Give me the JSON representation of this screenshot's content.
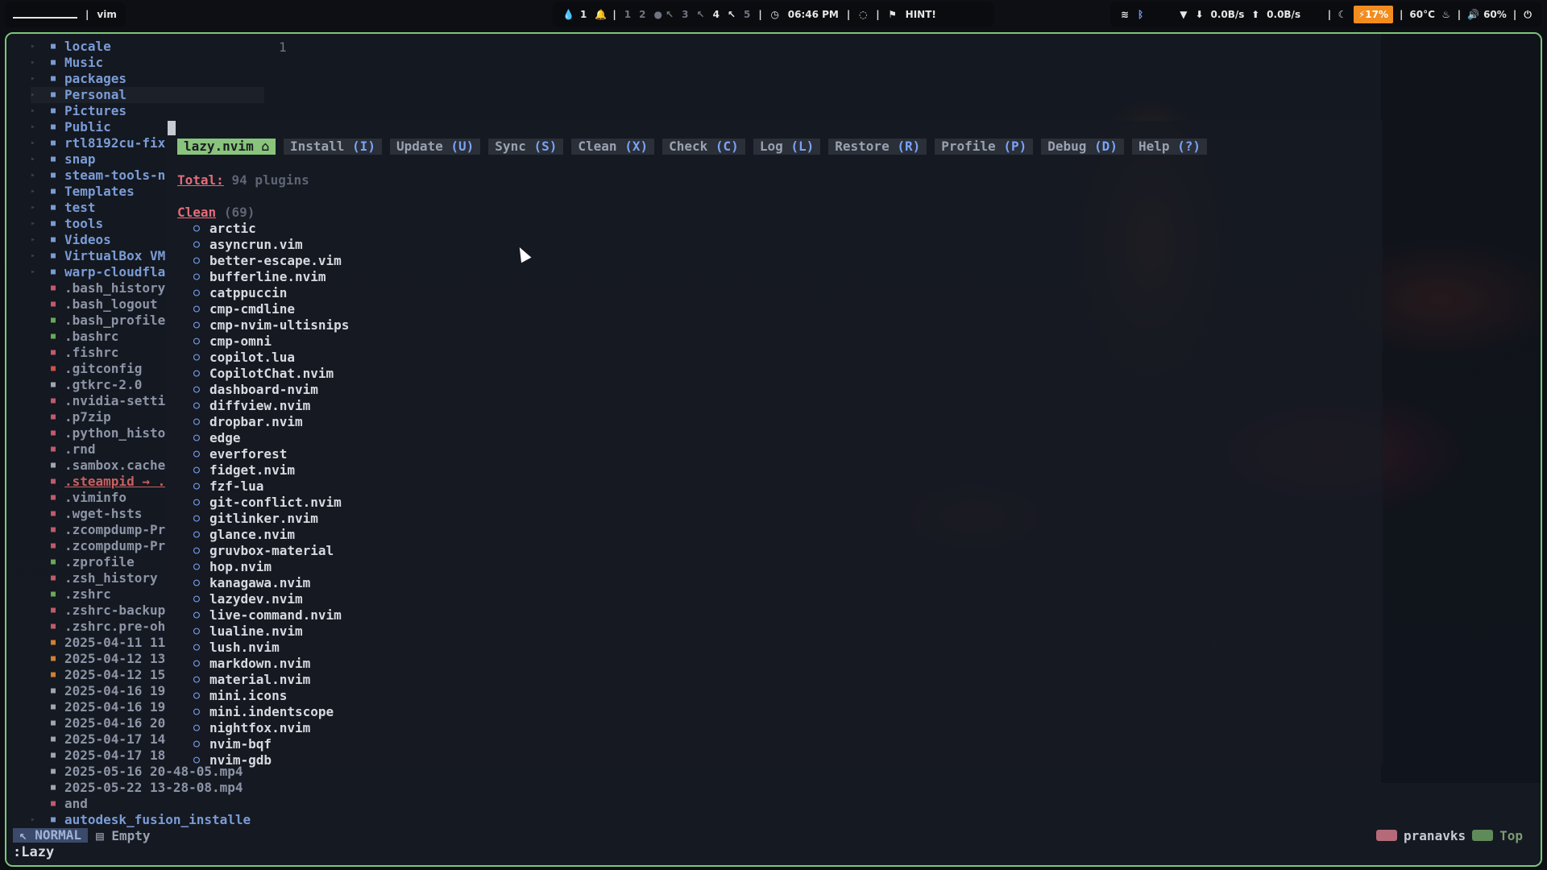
{
  "topbar": {
    "workspace_label": "vim",
    "notif_count": "1",
    "workspaces": [
      "1",
      "2",
      "3",
      "4",
      "5"
    ],
    "time": "06:46 PM",
    "hint": "HINT!",
    "net_down": "0.0B/s",
    "net_up": "0.0B/s",
    "battery": "17%",
    "temp": "60°C",
    "volume": "60%"
  },
  "tree": [
    {
      "name": "locale",
      "type": "dir"
    },
    {
      "name": "Music",
      "type": "dir"
    },
    {
      "name": "packages",
      "type": "dir"
    },
    {
      "name": "Personal",
      "type": "dir",
      "selected": true
    },
    {
      "name": "Pictures",
      "type": "dir"
    },
    {
      "name": "Public",
      "type": "dir"
    },
    {
      "name": "rtl8192cu-fix",
      "type": "dir"
    },
    {
      "name": "snap",
      "type": "dir"
    },
    {
      "name": "steam-tools-n",
      "type": "dir"
    },
    {
      "name": "Templates",
      "type": "dir"
    },
    {
      "name": "test",
      "type": "dir"
    },
    {
      "name": "tools",
      "type": "dir"
    },
    {
      "name": "Videos",
      "type": "dir"
    },
    {
      "name": "VirtualBox VM",
      "type": "dir"
    },
    {
      "name": "warp-cloudfla",
      "type": "dir"
    },
    {
      "name": ".bash_history",
      "type": "file",
      "color": "#c05a6e"
    },
    {
      "name": ".bash_logout",
      "type": "file",
      "color": "#c05a6e"
    },
    {
      "name": ".bash_profile",
      "type": "file",
      "color": "#6aa85a"
    },
    {
      "name": ".bashrc",
      "type": "file",
      "color": "#6aa85a"
    },
    {
      "name": ".fishrc",
      "type": "file",
      "color": "#c05a6e"
    },
    {
      "name": ".gitconfig",
      "type": "file",
      "color": "#d05040"
    },
    {
      "name": ".gtkrc-2.0",
      "type": "file",
      "color": "#a0a6b2"
    },
    {
      "name": ".nvidia-setti",
      "type": "file",
      "color": "#c05a6e"
    },
    {
      "name": ".p7zip",
      "type": "file",
      "color": "#c05a6e"
    },
    {
      "name": ".python_histo",
      "type": "file",
      "color": "#c05a6e"
    },
    {
      "name": ".rnd",
      "type": "file",
      "color": "#c05a6e"
    },
    {
      "name": ".sambox.cache",
      "type": "file",
      "color": "#a0a6b2"
    },
    {
      "name": ".steampid → .",
      "type": "link",
      "color": "#c05a6e"
    },
    {
      "name": ".viminfo",
      "type": "file",
      "color": "#c05a6e"
    },
    {
      "name": ".wget-hsts",
      "type": "file",
      "color": "#c05a6e"
    },
    {
      "name": ".zcompdump-Pr",
      "type": "file",
      "color": "#c05a6e"
    },
    {
      "name": ".zcompdump-Pr",
      "type": "file",
      "color": "#c05a6e"
    },
    {
      "name": ".zprofile",
      "type": "file",
      "color": "#6aa85a"
    },
    {
      "name": ".zsh_history",
      "type": "file",
      "color": "#c05a6e"
    },
    {
      "name": ".zshrc",
      "type": "file",
      "color": "#6aa85a"
    },
    {
      "name": ".zshrc-backup",
      "type": "file",
      "color": "#c05a6e"
    },
    {
      "name": ".zshrc.pre-oh",
      "type": "file",
      "color": "#c05a6e"
    },
    {
      "name": "2025-04-11 11",
      "type": "file",
      "color": "#d08030"
    },
    {
      "name": "2025-04-12 13",
      "type": "file",
      "color": "#d08030"
    },
    {
      "name": "2025-04-12 15",
      "type": "file",
      "color": "#d08030"
    },
    {
      "name": "2025-04-16 19",
      "type": "file",
      "color": "#a0a6b2"
    },
    {
      "name": "2025-04-16 19",
      "type": "file",
      "color": "#a0a6b2"
    },
    {
      "name": "2025-04-16 20",
      "type": "file",
      "color": "#a0a6b2"
    },
    {
      "name": "2025-04-17 14",
      "type": "file",
      "color": "#a0a6b2"
    },
    {
      "name": "2025-04-17 18",
      "type": "file",
      "color": "#a0a6b2"
    },
    {
      "name": "2025-05-16 20-48-05.mp4",
      "type": "file",
      "color": "#a0a6b2"
    },
    {
      "name": "2025-05-22 13-28-08.mp4",
      "type": "file",
      "color": "#a0a6b2"
    },
    {
      "name": "and",
      "type": "file",
      "color": "#c05a6e"
    },
    {
      "name": "autodesk_fusion_installe",
      "type": "dir"
    }
  ],
  "editor": {
    "line_number": "1"
  },
  "lazy": {
    "tabs": [
      {
        "label": "lazy.nvim ⌂",
        "key": "",
        "active": true
      },
      {
        "label": "Install",
        "key": "(I)"
      },
      {
        "label": "Update",
        "key": "(U)"
      },
      {
        "label": "Sync",
        "key": "(S)"
      },
      {
        "label": "Clean",
        "key": "(X)"
      },
      {
        "label": "Check",
        "key": "(C)"
      },
      {
        "label": "Log",
        "key": "(L)"
      },
      {
        "label": "Restore",
        "key": "(R)"
      },
      {
        "label": "Profile",
        "key": "(P)"
      },
      {
        "label": "Debug",
        "key": "(D)"
      },
      {
        "label": "Help",
        "key": "(?)"
      }
    ],
    "total_label": "Total:",
    "total_value": "94 plugins",
    "section_label": "Clean",
    "section_count": "(69)",
    "plugins": [
      "arctic",
      "asyncrun.vim",
      "better-escape.vim",
      "bufferline.nvim",
      "catppuccin",
      "cmp-cmdline",
      "cmp-nvim-ultisnips",
      "cmp-omni",
      "copilot.lua",
      "CopilotChat.nvim",
      "dashboard-nvim",
      "diffview.nvim",
      "dropbar.nvim",
      "edge",
      "everforest",
      "fidget.nvim",
      "fzf-lua",
      "git-conflict.nvim",
      "gitlinker.nvim",
      "glance.nvim",
      "gruvbox-material",
      "hop.nvim",
      "kanagawa.nvim",
      "lazydev.nvim",
      "live-command.nvim",
      "lualine.nvim",
      "lush.nvim",
      "markdown.nvim",
      "material.nvim",
      "mini.icons",
      "mini.indentscope",
      "nightfox.nvim",
      "nvim-bqf",
      "nvim-gdb"
    ]
  },
  "statusline": {
    "mode": "NORMAL",
    "buffer": "Empty",
    "user": "pranavks",
    "position": "Top"
  },
  "cmdline": ":Lazy"
}
